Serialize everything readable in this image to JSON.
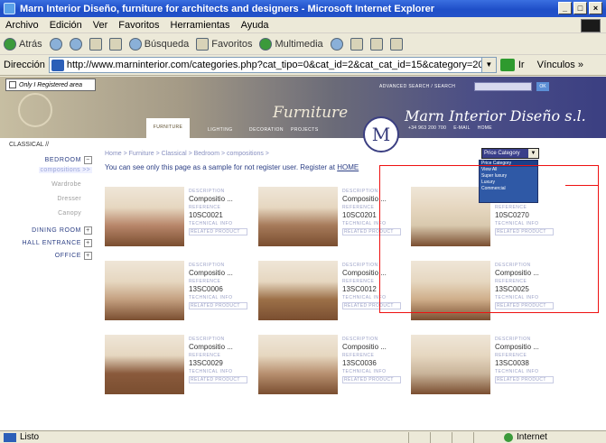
{
  "window": {
    "title": "Marn Interior Diseño, furniture for architects and designers - Microsoft Internet Explorer",
    "buttons": {
      "minimize": "_",
      "maximize": "□",
      "close": "×"
    }
  },
  "menu": [
    "Archivo",
    "Edición",
    "Ver",
    "Favoritos",
    "Herramientas",
    "Ayuda"
  ],
  "toolbar": {
    "back": "Atrás",
    "search": "Búsqueda",
    "favorites": "Favoritos",
    "multimedia": "Multimedia"
  },
  "address": {
    "label": "Dirección",
    "url": "http://www.marninterior.com/categories.php?cat_tipo=0&cat_id=2&cat_cat_id=15&category=20",
    "go": "Ir",
    "links": "Vínculos »"
  },
  "site": {
    "registered_tab": "Only I Registered area",
    "search_label": "ADVANCED SEARCH  /  SEARCH",
    "search_ok": "OK",
    "nav": [
      "FURNITURE",
      "LIGHTING",
      "DECORATION",
      "PROJECTS"
    ],
    "section_title": "Furniture",
    "company": "Marn Interior Diseño s.l.",
    "logo_letter": "M",
    "contacts": [
      "+34 963 200 700",
      "E-MAIL",
      "HOME"
    ]
  },
  "sidebar": {
    "title": "CLASSICAL //",
    "items": [
      {
        "label": "BEDROOM",
        "expander": "−"
      },
      {
        "label": "compositions >>",
        "sub": true,
        "selected": true
      },
      {
        "label": "Wardrobe",
        "sub": true
      },
      {
        "label": "Dresser",
        "sub": true
      },
      {
        "label": "Canopy",
        "sub": true
      },
      {
        "label": "DINING ROOM",
        "expander": "+"
      },
      {
        "label": "HALL ENTRANCE",
        "expander": "+"
      },
      {
        "label": "OFFICE",
        "expander": "+"
      }
    ]
  },
  "main": {
    "breadcrumb": "Home > Furniture > Classical > Bedroom > compositions >",
    "notice": "You can see only this page as a sample for not register user. Register at",
    "notice_link": "HOME"
  },
  "price_category": {
    "selected": "Price Category",
    "options": [
      "Price Category",
      "View All",
      "Super luxury",
      "Luxury",
      "Commercial"
    ]
  },
  "labels": {
    "description": "DESCRIPTION",
    "reference": "REFERENCE",
    "technical": "TECHNICAL INFO",
    "related": "RELATED PRODUCT"
  },
  "products": [
    {
      "name": "Compositio ...",
      "code": "10SC0021"
    },
    {
      "name": "Compositio ...",
      "code": "10SC0201"
    },
    {
      "name": "Compositio ...",
      "code": "10SC0270"
    },
    {
      "name": "Compositio ...",
      "code": "13SC0006"
    },
    {
      "name": "Compositio ...",
      "code": "13SC0012"
    },
    {
      "name": "Compositio ...",
      "code": "13SC0025"
    },
    {
      "name": "Compositio ...",
      "code": "13SC0029"
    },
    {
      "name": "Compositio ...",
      "code": "13SC0036"
    },
    {
      "name": "Compositio ...",
      "code": "13SC0038"
    }
  ],
  "status": {
    "left": "Listo",
    "zone": "Internet"
  }
}
